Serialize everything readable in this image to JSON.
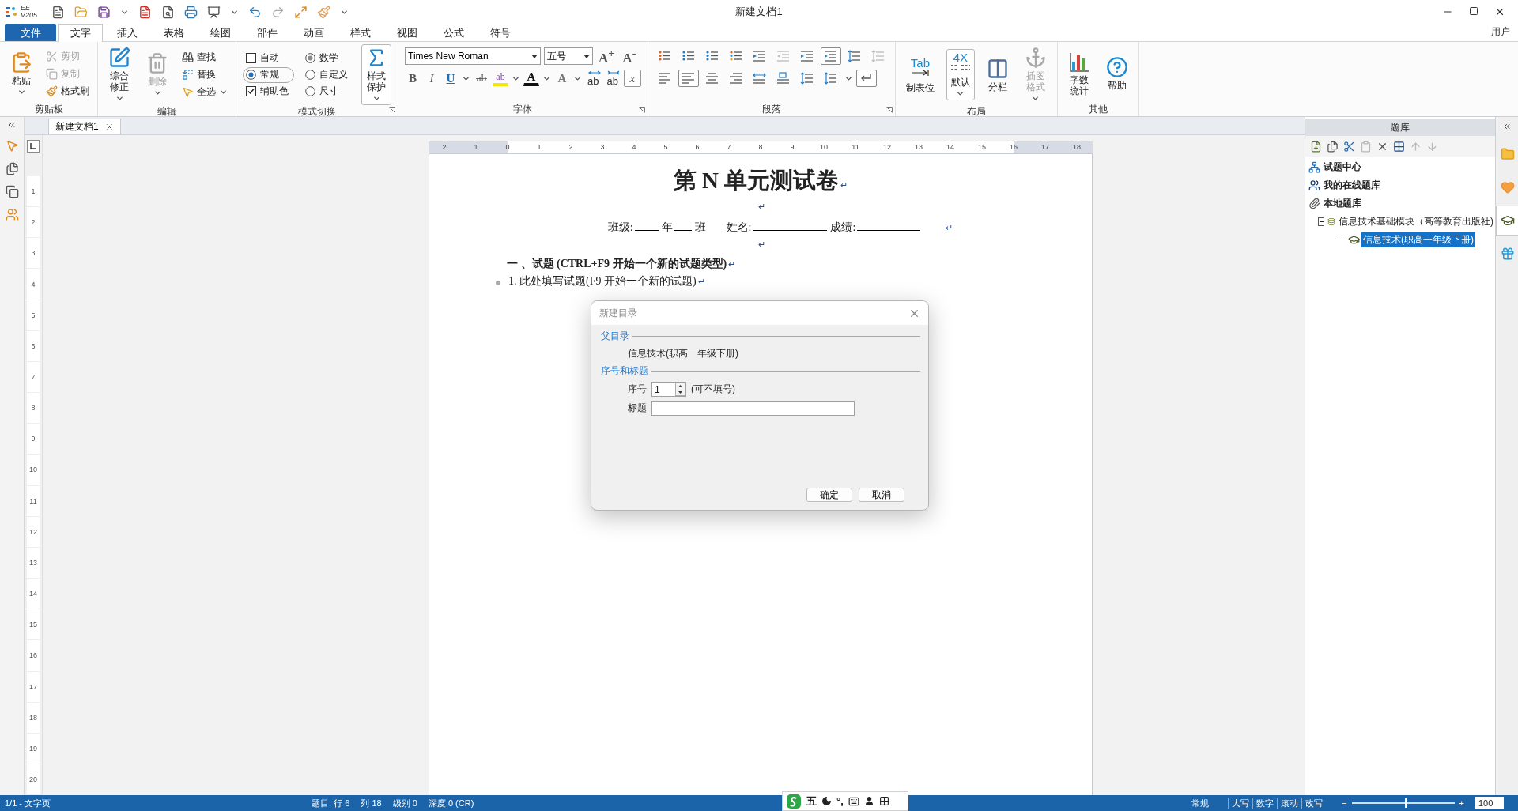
{
  "app": {
    "logo_top": "EE",
    "logo_bottom": "V205",
    "title": "新建文档1",
    "user": "用户"
  },
  "ribbon_tabs": [
    {
      "label": "文件",
      "kind": "file",
      "selected": false
    },
    {
      "label": "文字",
      "kind": "tab",
      "selected": true
    },
    {
      "label": "插入",
      "kind": "tab",
      "selected": false
    },
    {
      "label": "表格",
      "kind": "tab",
      "selected": false
    },
    {
      "label": "绘图",
      "kind": "tab",
      "selected": false
    },
    {
      "label": "部件",
      "kind": "tab",
      "selected": false
    },
    {
      "label": "动画",
      "kind": "tab",
      "selected": false
    },
    {
      "label": "样式",
      "kind": "tab",
      "selected": false
    },
    {
      "label": "视图",
      "kind": "tab",
      "selected": false
    },
    {
      "label": "公式",
      "kind": "tab",
      "selected": false
    },
    {
      "label": "符号",
      "kind": "tab",
      "selected": false
    }
  ],
  "ribbon_groups": [
    {
      "label": "剪贴板",
      "columns": [
        [
          {
            "kind": "large",
            "label": "粘贴",
            "caret": true,
            "disabled": false
          }
        ],
        [
          {
            "kind": "small",
            "label": "剪切",
            "disabled": true
          },
          {
            "kind": "small",
            "label": "复制",
            "disabled": true
          },
          {
            "kind": "small",
            "label": "格式刷",
            "disabled": false
          }
        ]
      ]
    },
    {
      "label": "编辑",
      "columns": [
        [
          {
            "kind": "large",
            "label": "综合修正",
            "caret": true,
            "disabled": false
          }
        ],
        [
          {
            "kind": "large",
            "label": "删除",
            "caret": true,
            "disabled": true
          }
        ],
        [
          {
            "kind": "small",
            "label": "查找",
            "disabled": false
          },
          {
            "kind": "small",
            "label": "替换",
            "disabled": false
          },
          {
            "kind": "small",
            "label": "全选",
            "caret": true,
            "disabled": false
          }
        ]
      ]
    },
    {
      "label": "模式切换",
      "launcher": true,
      "columns": [
        [
          {
            "kind": "check",
            "label": "自动",
            "checked": false
          },
          {
            "kind": "pill-radio",
            "label": "常规",
            "selected": true
          },
          {
            "kind": "check",
            "label": "辅助色",
            "checked": true
          }
        ],
        [
          {
            "kind": "radio",
            "label": "数学",
            "selected": true
          },
          {
            "kind": "radio",
            "label": "自定义",
            "selected": false
          },
          {
            "kind": "radio",
            "label": "尺寸",
            "selected": false
          }
        ],
        [
          {
            "kind": "gallery",
            "label": "样式保护",
            "caret": true,
            "disabled": false
          }
        ]
      ]
    },
    {
      "label": "字体",
      "launcher": true,
      "rows": [
        {
          "items": [
            {
              "kind": "combo",
              "value": "Times New Roman"
            },
            {
              "kind": "combo",
              "value": "五号"
            },
            {
              "kind": "glyph",
              "glyph": "A$^{+}$"
            },
            {
              "kind": "glyph",
              "glyph": "A$^{-}$"
            }
          ]
        },
        {
          "items": [
            {
              "kind": "glyph",
              "glyph": "B"
            },
            {
              "kind": "glyph",
              "glyph": "I"
            },
            {
              "kind": "glyph",
              "glyph": "U",
              "caret": true
            },
            {
              "kind": "glyph",
              "glyph": "ab"
            },
            {
              "kind": "glyph",
              "glyph": "ab",
              "caret": true
            },
            {
              "kind": "glyph",
              "glyph": "A",
              "caret": true
            },
            {
              "kind": "glyph",
              "glyph": "A",
              "caret": true
            },
            {
              "kind": "glyph",
              "glyph": "ab"
            },
            {
              "kind": "glyph",
              "glyph": "ab"
            },
            {
              "kind": "glyph",
              "glyph": "x"
            }
          ]
        }
      ]
    },
    {
      "label": "段落",
      "launcher": true,
      "rows": [
        {
          "items": [
            {
              "kind": "para",
              "selected": false,
              "disabled": false
            },
            {
              "kind": "para",
              "selected": false,
              "disabled": false
            },
            {
              "kind": "para",
              "selected": false,
              "disabled": false
            },
            {
              "kind": "para",
              "selected": false,
              "disabled": false
            },
            {
              "kind": "para",
              "selected": false,
              "disabled": false
            },
            {
              "kind": "para",
              "selected": false,
              "disabled": true
            },
            {
              "kind": "para",
              "selected": false,
              "disabled": false
            },
            {
              "kind": "para",
              "selected": true,
              "disabled": false
            },
            {
              "kind": "para",
              "selected": false,
              "disabled": false
            },
            {
              "kind": "para",
              "selected": false,
              "disabled": true
            }
          ]
        },
        {
          "items": [
            {
              "kind": "para",
              "selected": false,
              "disabled": false
            },
            {
              "kind": "para",
              "selected": true,
              "disabled": false
            },
            {
              "kind": "para",
              "selected": false,
              "disabled": false
            },
            {
              "kind": "para",
              "selected": false,
              "disabled": false
            },
            {
              "kind": "para",
              "selected": false,
              "disabled": false
            },
            {
              "kind": "para",
              "selected": false,
              "disabled": false
            },
            {
              "kind": "para",
              "selected": false,
              "disabled": false
            },
            {
              "kind": "para",
              "selected": false,
              "disabled": false,
              "caret": true
            },
            {
              "kind": "para",
              "selected": true,
              "disabled": false
            }
          ]
        }
      ]
    },
    {
      "label": "布局",
      "columns": [
        [
          {
            "kind": "large",
            "label": "制表位",
            "icon_text": "Tab",
            "disabled": false
          }
        ],
        [
          {
            "kind": "gallery",
            "label": "默认",
            "icon_text": "4X",
            "caret": true,
            "disabled": false
          }
        ],
        [
          {
            "kind": "large",
            "label": "分栏",
            "disabled": false
          }
        ],
        [
          {
            "kind": "large",
            "label": "插图格式",
            "caret": true,
            "disabled": true
          }
        ]
      ]
    },
    {
      "label": "其他",
      "columns": [
        [
          {
            "kind": "large",
            "label": "字数统计",
            "disabled": false
          }
        ],
        [
          {
            "kind": "large",
            "label": "帮助",
            "disabled": false
          }
        ]
      ]
    }
  ],
  "doc_tab": {
    "label": "新建文档1"
  },
  "h_ruler": [
    "2",
    "1",
    "0",
    "1",
    "2",
    "3",
    "4",
    "5",
    "6",
    "7",
    "8",
    "9",
    "10",
    "11",
    "12",
    "13",
    "14",
    "15",
    "16",
    "17",
    "18"
  ],
  "v_ruler": [
    "1",
    "2",
    "3",
    "4",
    "5",
    "6",
    "7",
    "8",
    "9",
    "10",
    "11",
    "12",
    "13",
    "14",
    "15",
    "16",
    "17",
    "18",
    "19",
    "20"
  ],
  "document": [
    {
      "kind": "title",
      "text": "第 N 单元测试卷",
      "mark": "↵"
    },
    {
      "kind": "empty",
      "mark": "↵"
    },
    {
      "kind": "form",
      "fields": [
        {
          "label": "班级:",
          "blank": true
        },
        {
          "label": "年",
          "blank": true
        },
        {
          "label": "班",
          "blank": false
        },
        {
          "label": "姓名:",
          "blank": true
        },
        {
          "label": "成绩:",
          "blank": true
        }
      ],
      "mark": "↵"
    },
    {
      "kind": "empty",
      "mark": "↵"
    },
    {
      "kind": "heading",
      "text": "一 、试题 (CTRL+F9 开始一个新的试题类型)",
      "mark": "↵"
    },
    {
      "kind": "item",
      "text": "1. 此处填写试题(F9 开始一个新的试题)",
      "mark": "↵"
    }
  ],
  "dialog": {
    "title": "新建目录",
    "parent_section": "父目录",
    "parent_value": "信息技术(职高一年级下册)",
    "number_section": "序号和标题",
    "number_label": "序号",
    "number_value": "1",
    "number_hint": "(可不填号)",
    "title_label": "标题",
    "buttons": [
      "确定",
      "取消"
    ]
  },
  "library": {
    "title": "题库",
    "toolbar": [
      {
        "disabled": false
      },
      {
        "disabled": false
      },
      {
        "disabled": false
      },
      {
        "disabled": true
      },
      {
        "disabled": false
      },
      {
        "disabled": false
      },
      {
        "disabled": true
      },
      {
        "disabled": true
      }
    ],
    "tree": [
      {
        "label": "试题中心",
        "selected": false
      },
      {
        "label": "我的在线题库",
        "selected": false
      },
      {
        "label": "本地题库",
        "selected": false,
        "children": [
          {
            "label": "信息技术基础模块（高等教育出版社)",
            "selected": false,
            "expanded": true,
            "children": [
              {
                "label": "信息技术(职高一年级下册)",
                "selected": true
              }
            ]
          }
        ]
      }
    ]
  },
  "side_tabs": [
    {
      "selected": false
    },
    {
      "selected": false
    },
    {
      "selected": true
    },
    {
      "selected": false
    }
  ],
  "ime": {
    "label": "五",
    "punct": "°,"
  },
  "status": {
    "page": "1/1 - 文字页",
    "fields": [
      "题目: 行 6",
      "列 18",
      "级别 0",
      "深度 0 (CR)"
    ],
    "modes": [
      "常规",
      "大写",
      "数字",
      "滚动",
      "改写"
    ],
    "zoom": {
      "minus": "−",
      "plus": "+",
      "level": 0.52,
      "value": "100"
    }
  }
}
